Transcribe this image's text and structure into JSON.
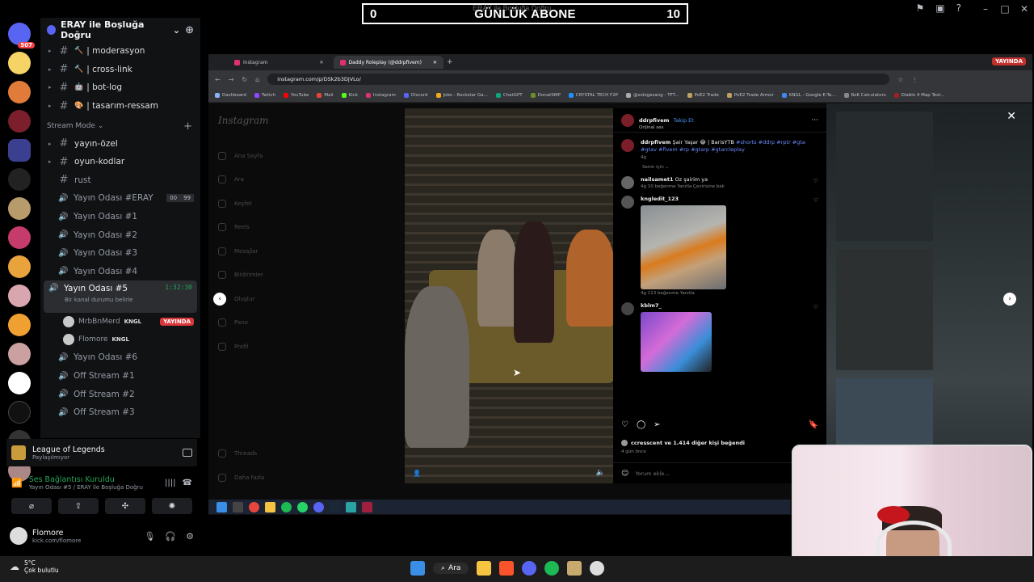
{
  "overlay": {
    "left_score": "0",
    "title": "GÜNLÜK ABONE",
    "right_score": "10",
    "ghost_text": "ERAY ile Boşluğa Doğru"
  },
  "server": {
    "name": "ERAY ile Boşluğa Doğru",
    "unread_badge": "507"
  },
  "channels": [
    {
      "kind": "text",
      "label": "| moderasyon",
      "emoji": "🔨"
    },
    {
      "kind": "text",
      "label": "| cross-link",
      "emoji": "🔨"
    },
    {
      "kind": "text",
      "label": "| bot-log",
      "emoji": "🤖"
    },
    {
      "kind": "text",
      "label": "| tasarım-ressam",
      "emoji": "🎨"
    }
  ],
  "category": {
    "label": "Stream Mode"
  },
  "stream_channels": [
    {
      "kind": "text",
      "label": "yayın-özel"
    },
    {
      "kind": "text",
      "label": "oyun-kodlar"
    },
    {
      "kind": "text",
      "label": "rust"
    },
    {
      "kind": "voice",
      "label": "Yayın Odası #ERAY",
      "pill": [
        "00",
        "99"
      ]
    },
    {
      "kind": "voice",
      "label": "Yayın Odası #1"
    },
    {
      "kind": "voice",
      "label": "Yayın Odası #2"
    },
    {
      "kind": "voice",
      "label": "Yayın Odası #3"
    },
    {
      "kind": "voice",
      "label": "Yayın Odası #4"
    }
  ],
  "active_channel": {
    "label": "Yayın Odası #5",
    "timer": "1:32:30",
    "status": "Bir kanal durumu belirle"
  },
  "members": [
    {
      "name": "MrbBnMerd",
      "tag": "KNGL",
      "live": "YAYINDA"
    },
    {
      "name": "Flomore",
      "tag": "KNGL"
    }
  ],
  "after_channels": [
    {
      "kind": "voice",
      "label": "Yayın Odası #6"
    },
    {
      "kind": "voice",
      "label": "Off Stream #1"
    },
    {
      "kind": "voice",
      "label": "Off Stream #2"
    },
    {
      "kind": "voice",
      "label": "Off Stream #3"
    }
  ],
  "activity": {
    "game": "League of Legends",
    "sub": "Paylaşılmıyor"
  },
  "voice": {
    "status": "Ses Bağlantısı Kuruldu",
    "sub": "Yayın Odası #5 / ERAY ile Boşluğa Doğru"
  },
  "user": {
    "name": "Flomore",
    "sub": "kick.com/flomore"
  },
  "weather": {
    "temp": "5°C",
    "desc": "Çok bulutlu"
  },
  "taskbar": {
    "search": "Ara"
  },
  "browser": {
    "tabs": [
      "Instagram",
      "Daddy Roleplay (@ddrpfivem)"
    ],
    "live": "YAYINDA",
    "url": "instagram.com/p/DSk2b3DjVLo/",
    "bookmarks": [
      "Dashboard",
      "Twitch",
      "YouTube",
      "Mail",
      "Kick",
      "Instagram",
      "Discord",
      "Jobs - Rockstar Ga...",
      "ChatGPT",
      "DonatSMP",
      "CRYSTAL TECH F2P",
      "@sologesang - TFT...",
      "PoE2 Trade",
      "PoE2 Trade Armor",
      "KNGL - Google E-Ta...",
      "RoK Calculators",
      "Diablo 4 Map Tool..."
    ]
  },
  "instagram": {
    "logo": "Instagram",
    "nav": [
      "Ana Sayfa",
      "Ara",
      "Keşfet",
      "Reels",
      "Mesajlar",
      "Bildirimler",
      "Oluştur",
      "Pano",
      "Profil"
    ],
    "bottom_nav": [
      "Threads",
      "Daha fazla"
    ],
    "post_author": "ddrpfivem",
    "follow": "Takip Et",
    "audio": "Orijinal ses",
    "caption": "Şair Yaşar 😂 | BarisYTB",
    "caption_tags": "#shorts #ddrp #rptr #gta #gtav #fivem #rp #gtarp #gtarcleplay",
    "caption_age": "4g",
    "see_translation": "Senin için ⌄",
    "comments": [
      {
        "user": "nailsamet1",
        "text": "Oz şairim ya",
        "meta": "4g   10 beğenme   Yanıtla   Çevirisine bak"
      },
      {
        "user": "kngledit_123",
        "text": "",
        "meta": "4g   113 beğenme   Yanıtla"
      },
      {
        "user": "kblm7_",
        "text": "",
        "meta": ""
      }
    ],
    "likes": "ccresscent ve 1.414 diğer kişi beğendi",
    "date": "4 gün önce",
    "comment_placeholder": "Yorum ekle..."
  }
}
